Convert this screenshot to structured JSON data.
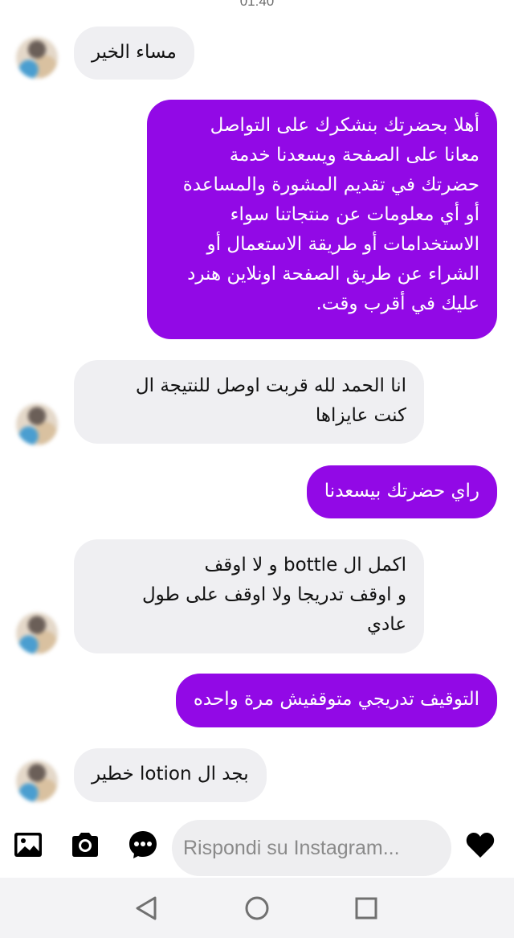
{
  "status_bar": {
    "time": "01:40"
  },
  "conversation": {
    "messages": [
      {
        "direction": "in",
        "text": "مساء الخير"
      },
      {
        "direction": "out",
        "text": "أهلا بحضرتك بنشكرك على التواصل\nمعانا على الصفحة ويسعدنا خدمة\nحضرتك في تقديم المشورة والمساعدة\nأو أي معلومات عن منتجاتنا سواء\nالاستخدامات أو طريقة الاستعمال أو\nالشراء عن طريق الصفحة اونلاين هنرد\nعليك في أقرب وقت."
      },
      {
        "direction": "in",
        "text": "انا الحمد لله قربت اوصل للنتيجة ال\nكنت عايزاها"
      },
      {
        "direction": "out",
        "text": "راي حضرتك بيسعدنا"
      },
      {
        "direction": "in",
        "text": "اكمل ال bottle و لا اوقف\nو اوقف تدريجا ولا اوقف على طول\nعادي"
      },
      {
        "direction": "out",
        "text": "التوقيف تدريجي متوقفيش مرة واحده"
      },
      {
        "direction": "in",
        "text": "بجد ال lotion خطير"
      }
    ]
  },
  "composer": {
    "placeholder": "Rispondi su Instagram...",
    "icons": [
      "gallery-icon",
      "camera-icon",
      "message-bubble-icon",
      "heart-icon"
    ]
  },
  "navigation": {
    "icons": [
      "back-icon",
      "home-icon",
      "recents-icon"
    ]
  },
  "colors": {
    "accent": "#9209e6",
    "incoming_bubble": "#efeff2",
    "navbar": "#f3f3f5"
  }
}
